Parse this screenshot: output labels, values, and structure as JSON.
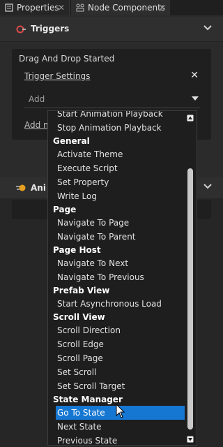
{
  "tabs": [
    {
      "label": "Properties",
      "icon": "properties-icon",
      "active": false
    },
    {
      "label": "Node Components",
      "icon": "node-components-icon",
      "active": true
    }
  ],
  "triggers": {
    "header": "Triggers",
    "card_title": "Drag And Drop Started",
    "settings_link": "Trigger Settings",
    "add_placeholder": "Add",
    "add_new_link": "Add ne"
  },
  "animations": {
    "header": "Ani"
  },
  "dropdown": {
    "items": [
      {
        "type": "item",
        "label": "Start Animation Playback"
      },
      {
        "type": "item",
        "label": "Stop Animation Playback"
      },
      {
        "type": "header",
        "label": "General"
      },
      {
        "type": "item",
        "label": "Activate Theme"
      },
      {
        "type": "item",
        "label": "Execute Script"
      },
      {
        "type": "item",
        "label": "Set Property"
      },
      {
        "type": "item",
        "label": "Write Log"
      },
      {
        "type": "header",
        "label": "Page"
      },
      {
        "type": "item",
        "label": "Navigate To Page"
      },
      {
        "type": "item",
        "label": "Navigate To Parent"
      },
      {
        "type": "header",
        "label": "Page Host"
      },
      {
        "type": "item",
        "label": "Navigate To Next"
      },
      {
        "type": "item",
        "label": "Navigate To Previous"
      },
      {
        "type": "header",
        "label": "Prefab View"
      },
      {
        "type": "item",
        "label": "Start Asynchronous Load"
      },
      {
        "type": "header",
        "label": "Scroll View"
      },
      {
        "type": "item",
        "label": "Scroll Direction"
      },
      {
        "type": "item",
        "label": "Scroll Edge"
      },
      {
        "type": "item",
        "label": "Scroll Page"
      },
      {
        "type": "item",
        "label": "Set Scroll"
      },
      {
        "type": "item",
        "label": "Set Scroll Target"
      },
      {
        "type": "header",
        "label": "State Manager"
      },
      {
        "type": "item",
        "label": "Go To State",
        "selected": true
      },
      {
        "type": "item",
        "label": "Next State"
      },
      {
        "type": "item",
        "label": "Previous State"
      }
    ]
  },
  "colors": {
    "selection": "#1677d2",
    "background": "#2b2b2b",
    "trigger_icon": "#d84a4a",
    "animation_icon": "#e8a020"
  }
}
